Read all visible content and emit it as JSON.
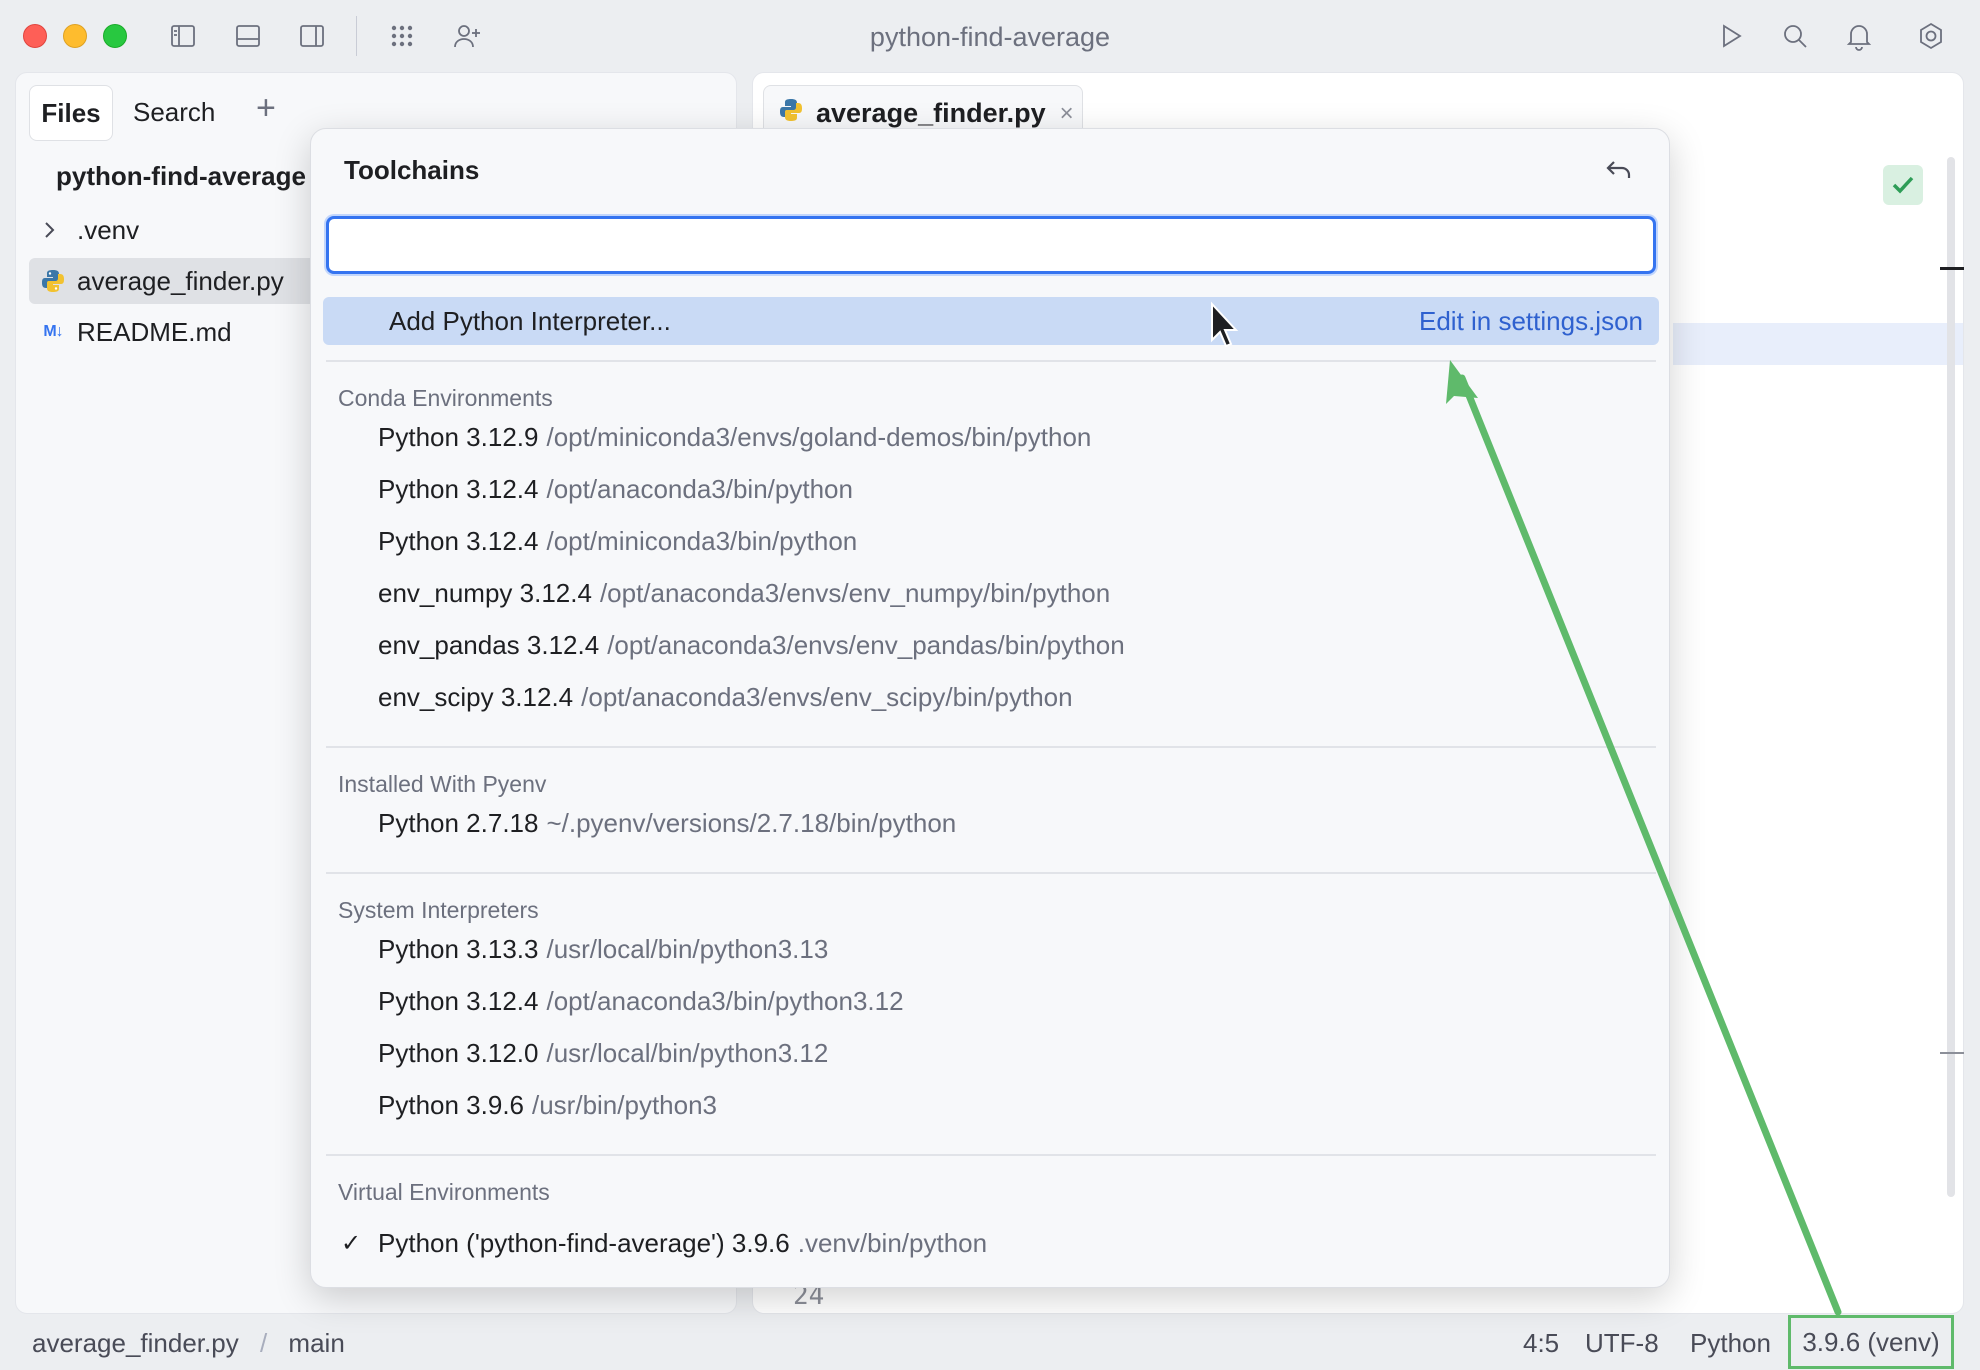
{
  "window": {
    "title": "python-find-average"
  },
  "sidebar": {
    "tabs": {
      "files": "Files",
      "search": "Search",
      "add": "+"
    },
    "project_root": "python-find-average",
    "items": [
      {
        "label": ".venv",
        "icon": "chevron-right-icon"
      },
      {
        "label": "average_finder.py",
        "icon": "python-file-icon"
      },
      {
        "label": "README.md",
        "icon": "markdown-icon",
        "icon_text": "M↓"
      }
    ]
  },
  "editor": {
    "tab_label": "average_finder.py",
    "tab_close": "×",
    "visible_line_number": "24"
  },
  "popup": {
    "title": "Toolchains",
    "search_value": "",
    "add_label": "Add Python Interpreter...",
    "edit_link": "Edit in settings.json",
    "sections": [
      {
        "title": "Conda Environments",
        "items": [
          {
            "name": "Python 3.12.9",
            "path": "/opt/miniconda3/envs/goland-demos/bin/python"
          },
          {
            "name": "Python 3.12.4",
            "path": "/opt/anaconda3/bin/python"
          },
          {
            "name": "Python 3.12.4",
            "path": "/opt/miniconda3/bin/python"
          },
          {
            "name": "env_numpy 3.12.4",
            "path": "/opt/anaconda3/envs/env_numpy/bin/python"
          },
          {
            "name": "env_pandas 3.12.4",
            "path": "/opt/anaconda3/envs/env_pandas/bin/python"
          },
          {
            "name": "env_scipy 3.12.4",
            "path": "/opt/anaconda3/envs/env_scipy/bin/python"
          }
        ]
      },
      {
        "title": "Installed With Pyenv",
        "items": [
          {
            "name": "Python 2.7.18",
            "path": "~/.pyenv/versions/2.7.18/bin/python"
          }
        ]
      },
      {
        "title": "System Interpreters",
        "items": [
          {
            "name": "Python 3.13.3",
            "path": "/usr/local/bin/python3.13"
          },
          {
            "name": "Python 3.12.4",
            "path": "/opt/anaconda3/bin/python3.12"
          },
          {
            "name": "Python 3.12.0",
            "path": "/usr/local/bin/python3.12"
          },
          {
            "name": "Python 3.9.6",
            "path": "/usr/bin/python3"
          }
        ]
      },
      {
        "title": "Virtual Environments",
        "items": [
          {
            "name": "Python ('python-find-average') 3.9.6",
            "path": ".venv/bin/python",
            "selected": true,
            "check": "✓"
          }
        ]
      }
    ]
  },
  "statusbar": {
    "file": "average_finder.py",
    "separator": "/",
    "branch": "main",
    "position": "4:5",
    "encoding": "UTF-8",
    "language": "Python",
    "interpreter": "3.9.6 (venv)"
  },
  "colors": {
    "accent": "#3574f0",
    "selection": "#c9daf5",
    "annotation": "#5fba6b",
    "link": "#2f61cf"
  }
}
